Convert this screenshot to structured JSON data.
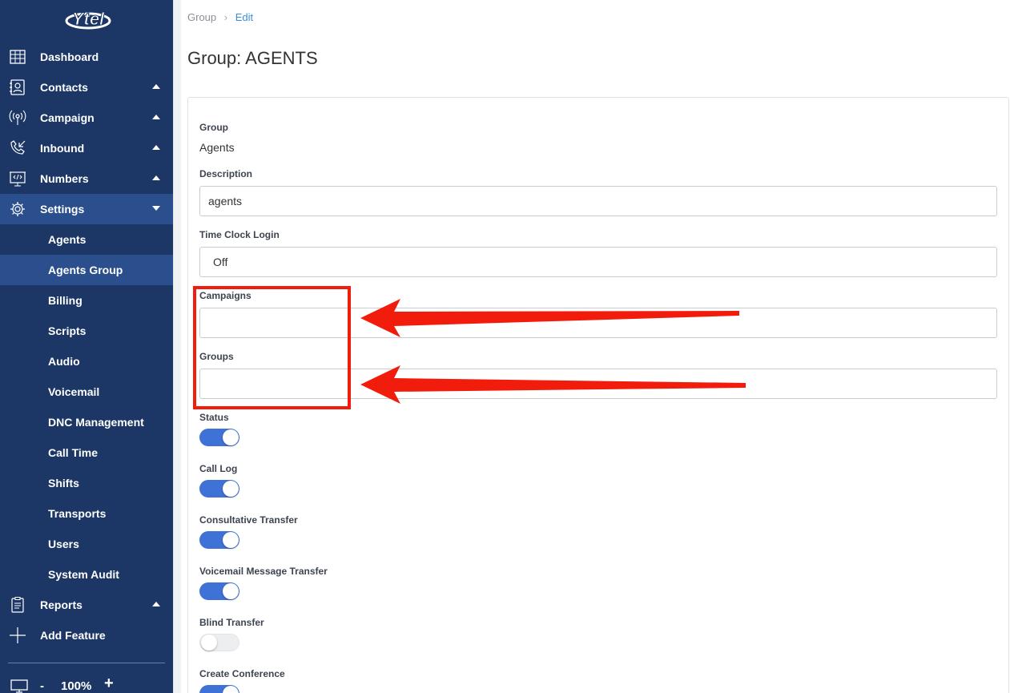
{
  "brand": {
    "logo_text": "Ytel"
  },
  "sidebar": {
    "items": [
      {
        "label": "Dashboard",
        "icon": "dashboard-icon",
        "caret": "none"
      },
      {
        "label": "Contacts",
        "icon": "contacts-icon",
        "caret": "up"
      },
      {
        "label": "Campaign",
        "icon": "campaign-icon",
        "caret": "up"
      },
      {
        "label": "Inbound",
        "icon": "inbound-icon",
        "caret": "up"
      },
      {
        "label": "Numbers",
        "icon": "numbers-icon",
        "caret": "up"
      },
      {
        "label": "Settings",
        "icon": "settings-icon",
        "caret": "down",
        "active": true
      }
    ],
    "settings_sub": [
      {
        "label": "Agents"
      },
      {
        "label": "Agents Group",
        "active": true
      },
      {
        "label": "Billing"
      },
      {
        "label": "Scripts"
      },
      {
        "label": "Audio"
      },
      {
        "label": "Voicemail"
      },
      {
        "label": "DNC Management"
      },
      {
        "label": "Call Time"
      },
      {
        "label": "Shifts"
      },
      {
        "label": "Transports"
      },
      {
        "label": "Users"
      },
      {
        "label": "System Audit"
      }
    ],
    "reports": {
      "label": "Reports",
      "icon": "reports-icon",
      "caret": "up"
    },
    "add_feature": {
      "label": "Add Feature",
      "icon": "plus-icon"
    },
    "zoom": {
      "minus": "-",
      "level": "100%",
      "plus": "+"
    }
  },
  "breadcrumb": {
    "root": "Group",
    "current": "Edit"
  },
  "page": {
    "title": "Group: AGENTS"
  },
  "form": {
    "group": {
      "label": "Group",
      "value": "Agents"
    },
    "description": {
      "label": "Description",
      "value": "agents"
    },
    "time_clock_login": {
      "label": "Time Clock Login",
      "value": "Off"
    },
    "campaigns": {
      "label": "Campaigns",
      "value": ""
    },
    "groups": {
      "label": "Groups",
      "value": ""
    },
    "toggles": [
      {
        "label": "Status",
        "on": true
      },
      {
        "label": "Call Log",
        "on": true
      },
      {
        "label": "Consultative Transfer",
        "on": true
      },
      {
        "label": "Voicemail Message Transfer",
        "on": true
      },
      {
        "label": "Blind Transfer",
        "on": false
      },
      {
        "label": "Create Conference",
        "on": true
      }
    ]
  },
  "colors": {
    "sidebar_bg": "#1c3766",
    "sidebar_active": "#2b4e8c",
    "toggle_on": "#3f72d6",
    "annotation": "#f21c0d",
    "link": "#3b8fd9"
  }
}
